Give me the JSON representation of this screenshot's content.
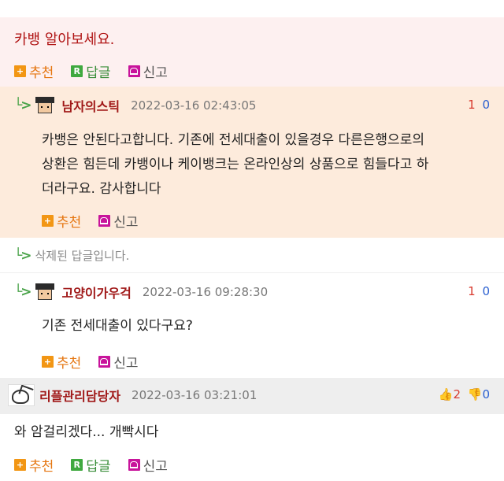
{
  "post": {
    "text": "카뱅 알아보세요.",
    "actions": {
      "recommend": "추천",
      "reply": "답글",
      "report": "신고"
    }
  },
  "reply1": {
    "author": "남자의스틱",
    "date": "2022-03-16 02:43:05",
    "vote_up": "1",
    "vote_down": "0",
    "lines": [
      "카뱅은 안된다고합니다. 기존에 전세대출이 있을경우 다른은행으로의",
      "상환은 힘든데 카뱅이나 케이뱅크는 온라인상의 상품으로 힘들다고 하",
      "더라구요. 감사합니다"
    ],
    "actions": {
      "recommend": "추천",
      "report": "신고"
    }
  },
  "deleted": {
    "text": "삭제된 답글입니다."
  },
  "reply2": {
    "author": "고양이가우걱",
    "date": "2022-03-16 09:28:30",
    "vote_up": "1",
    "vote_down": "0",
    "text": "기존 전세대출이 있다구요?",
    "actions": {
      "recommend": "추천",
      "report": "신고"
    }
  },
  "comment2": {
    "author": "리플관리담당자",
    "date": "2022-03-16 03:21:01",
    "thumbs_up": "2",
    "thumbs_down": "0",
    "text": "와 암걸리겠다... 개빡시다",
    "actions": {
      "recommend": "추천",
      "reply": "답글",
      "report": "신고"
    }
  },
  "colors": {
    "post_bg": "#fdf0f0",
    "reply_bg": "#fdebdc",
    "header_bg": "#eeeeee",
    "author": "#a01818",
    "reply_arrow": "#4aa34a"
  },
  "icons": {
    "recommend": "plus-square-icon",
    "reply": "r-square-icon",
    "report": "siren-icon",
    "reply_marker": "reply-arrow-icon",
    "thumbs_up": "thumbs-up-icon",
    "thumbs_down": "thumbs-down-icon"
  }
}
